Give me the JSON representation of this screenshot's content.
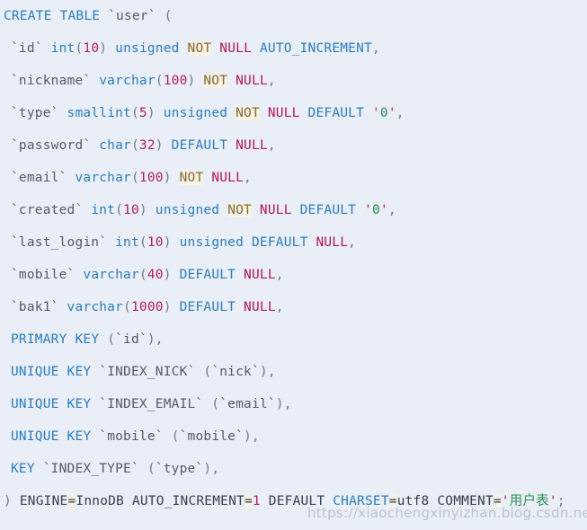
{
  "editor": {
    "language": "sql",
    "background_color": "#e9eef7",
    "keyword_color": "#2b7dbc",
    "null_color": "#b0165c",
    "number_color": "#b02060",
    "string_color": "#2f8f4e",
    "identifier_color": "#555b66",
    "highlight_color": "#f7f3e3"
  },
  "watermark": {
    "text": "https://xiaochengxinyizhan.blog.csdn.net"
  },
  "sql": {
    "statement_name": "create-table-user",
    "lines": [
      {
        "id": "line-create-table",
        "indent": false,
        "tokens": [
          {
            "t": "CREATE",
            "c": "kw"
          },
          {
            "t": " ",
            "c": "plain"
          },
          {
            "t": "TABLE",
            "c": "kw"
          },
          {
            "t": " ",
            "c": "plain"
          },
          {
            "t": "`user`",
            "c": "ident"
          },
          {
            "t": " ",
            "c": "plain"
          },
          {
            "t": "(",
            "c": "punct"
          }
        ]
      },
      {
        "id": "line-col-id",
        "indent": true,
        "tokens": [
          {
            "t": "`id`",
            "c": "ident"
          },
          {
            "t": " ",
            "c": "plain"
          },
          {
            "t": "int",
            "c": "type"
          },
          {
            "t": "(",
            "c": "punct"
          },
          {
            "t": "10",
            "c": "num"
          },
          {
            "t": ")",
            "c": "punct"
          },
          {
            "t": " ",
            "c": "plain"
          },
          {
            "t": "unsigned",
            "c": "kw"
          },
          {
            "t": " ",
            "c": "plain"
          },
          {
            "t": "NOT",
            "c": "notkw"
          },
          {
            "t": " ",
            "c": "plain"
          },
          {
            "t": "NULL",
            "c": "nullkw"
          },
          {
            "t": " ",
            "c": "plain"
          },
          {
            "t": "AUTO_INCREMENT",
            "c": "kw"
          },
          {
            "t": ",",
            "c": "punct"
          }
        ]
      },
      {
        "id": "line-col-nickname",
        "indent": true,
        "tokens": [
          {
            "t": "`nickname`",
            "c": "ident"
          },
          {
            "t": " ",
            "c": "plain"
          },
          {
            "t": "varchar",
            "c": "type"
          },
          {
            "t": "(",
            "c": "punct"
          },
          {
            "t": "100",
            "c": "num"
          },
          {
            "t": ")",
            "c": "punct"
          },
          {
            "t": " ",
            "c": "plain"
          },
          {
            "t": "NOT",
            "c": "notkw"
          },
          {
            "t": " ",
            "c": "plain"
          },
          {
            "t": "NULL",
            "c": "nullkw"
          },
          {
            "t": ",",
            "c": "punct"
          }
        ]
      },
      {
        "id": "line-col-type",
        "indent": true,
        "tokens": [
          {
            "t": "`type`",
            "c": "ident"
          },
          {
            "t": " ",
            "c": "plain"
          },
          {
            "t": "smallint",
            "c": "type"
          },
          {
            "t": "(",
            "c": "punct"
          },
          {
            "t": "5",
            "c": "num"
          },
          {
            "t": ")",
            "c": "punct"
          },
          {
            "t": " ",
            "c": "plain"
          },
          {
            "t": "unsigned",
            "c": "kw"
          },
          {
            "t": " ",
            "c": "plain"
          },
          {
            "t": "NOT",
            "c": "notkw"
          },
          {
            "t": " ",
            "c": "plain"
          },
          {
            "t": "NULL",
            "c": "nullkw"
          },
          {
            "t": " ",
            "c": "plain"
          },
          {
            "t": "DEFAULT",
            "c": "kw"
          },
          {
            "t": " ",
            "c": "plain"
          },
          {
            "t": "'",
            "c": "strq"
          },
          {
            "t": "0",
            "c": "strv"
          },
          {
            "t": "'",
            "c": "strq"
          },
          {
            "t": ",",
            "c": "punct"
          }
        ]
      },
      {
        "id": "line-col-password",
        "indent": true,
        "tokens": [
          {
            "t": "`password`",
            "c": "ident"
          },
          {
            "t": " ",
            "c": "plain"
          },
          {
            "t": "char",
            "c": "type"
          },
          {
            "t": "(",
            "c": "punct"
          },
          {
            "t": "32",
            "c": "num"
          },
          {
            "t": ")",
            "c": "punct"
          },
          {
            "t": " ",
            "c": "plain"
          },
          {
            "t": "DEFAULT",
            "c": "kw"
          },
          {
            "t": " ",
            "c": "plain"
          },
          {
            "t": "NULL",
            "c": "nullkw"
          },
          {
            "t": ",",
            "c": "punct"
          }
        ]
      },
      {
        "id": "line-col-email",
        "indent": true,
        "tokens": [
          {
            "t": "`email`",
            "c": "ident"
          },
          {
            "t": " ",
            "c": "plain"
          },
          {
            "t": "varchar",
            "c": "type"
          },
          {
            "t": "(",
            "c": "punct"
          },
          {
            "t": "100",
            "c": "num"
          },
          {
            "t": ")",
            "c": "punct"
          },
          {
            "t": " ",
            "c": "plain"
          },
          {
            "t": "NOT",
            "c": "notkw"
          },
          {
            "t": " ",
            "c": "plain"
          },
          {
            "t": "NULL",
            "c": "nullkw"
          },
          {
            "t": ",",
            "c": "punct"
          }
        ]
      },
      {
        "id": "line-col-created",
        "indent": true,
        "tokens": [
          {
            "t": "`created`",
            "c": "ident"
          },
          {
            "t": " ",
            "c": "plain"
          },
          {
            "t": "int",
            "c": "type"
          },
          {
            "t": "(",
            "c": "punct"
          },
          {
            "t": "10",
            "c": "num"
          },
          {
            "t": ")",
            "c": "punct"
          },
          {
            "t": " ",
            "c": "plain"
          },
          {
            "t": "unsigned",
            "c": "kw"
          },
          {
            "t": " ",
            "c": "plain"
          },
          {
            "t": "NOT",
            "c": "notkw"
          },
          {
            "t": " ",
            "c": "plain"
          },
          {
            "t": "NULL",
            "c": "nullkw"
          },
          {
            "t": " ",
            "c": "plain"
          },
          {
            "t": "DEFAULT",
            "c": "kw"
          },
          {
            "t": " ",
            "c": "plain"
          },
          {
            "t": "'",
            "c": "strq"
          },
          {
            "t": "0",
            "c": "strv"
          },
          {
            "t": "'",
            "c": "strq"
          },
          {
            "t": ",",
            "c": "punct"
          }
        ]
      },
      {
        "id": "line-col-last-login",
        "indent": true,
        "tokens": [
          {
            "t": "`last_login`",
            "c": "ident"
          },
          {
            "t": " ",
            "c": "plain"
          },
          {
            "t": "int",
            "c": "type"
          },
          {
            "t": "(",
            "c": "punct"
          },
          {
            "t": "10",
            "c": "num"
          },
          {
            "t": ")",
            "c": "punct"
          },
          {
            "t": " ",
            "c": "plain"
          },
          {
            "t": "unsigned",
            "c": "kw"
          },
          {
            "t": " ",
            "c": "plain"
          },
          {
            "t": "DEFAULT",
            "c": "kw"
          },
          {
            "t": " ",
            "c": "plain"
          },
          {
            "t": "NULL",
            "c": "nullkw"
          },
          {
            "t": ",",
            "c": "punct"
          }
        ]
      },
      {
        "id": "line-col-mobile",
        "indent": true,
        "tokens": [
          {
            "t": "`mobile`",
            "c": "ident"
          },
          {
            "t": " ",
            "c": "plain"
          },
          {
            "t": "varchar",
            "c": "type"
          },
          {
            "t": "(",
            "c": "punct"
          },
          {
            "t": "40",
            "c": "num"
          },
          {
            "t": ")",
            "c": "punct"
          },
          {
            "t": " ",
            "c": "plain"
          },
          {
            "t": "DEFAULT",
            "c": "kw"
          },
          {
            "t": " ",
            "c": "plain"
          },
          {
            "t": "NULL",
            "c": "nullkw"
          },
          {
            "t": ",",
            "c": "punct"
          }
        ]
      },
      {
        "id": "line-col-bak1",
        "indent": true,
        "tokens": [
          {
            "t": "`bak1`",
            "c": "ident"
          },
          {
            "t": " ",
            "c": "plain"
          },
          {
            "t": "varchar",
            "c": "type"
          },
          {
            "t": "(",
            "c": "punct"
          },
          {
            "t": "1000",
            "c": "num"
          },
          {
            "t": ")",
            "c": "punct"
          },
          {
            "t": " ",
            "c": "plain"
          },
          {
            "t": "DEFAULT",
            "c": "kw"
          },
          {
            "t": " ",
            "c": "plain"
          },
          {
            "t": "NULL",
            "c": "nullkw"
          },
          {
            "t": ",",
            "c": "punct"
          }
        ]
      },
      {
        "id": "line-primary-key",
        "indent": true,
        "tokens": [
          {
            "t": "PRIMARY",
            "c": "kw"
          },
          {
            "t": " ",
            "c": "plain"
          },
          {
            "t": "KEY",
            "c": "kw"
          },
          {
            "t": " ",
            "c": "plain"
          },
          {
            "t": "(",
            "c": "punct"
          },
          {
            "t": "`id`",
            "c": "ident"
          },
          {
            "t": ")",
            "c": "punct"
          },
          {
            "t": ",",
            "c": "punct"
          }
        ]
      },
      {
        "id": "line-unique-key-index-nick",
        "indent": true,
        "tokens": [
          {
            "t": "UNIQUE",
            "c": "kw"
          },
          {
            "t": " ",
            "c": "plain"
          },
          {
            "t": "KEY",
            "c": "kw"
          },
          {
            "t": " ",
            "c": "plain"
          },
          {
            "t": "`INDEX_NICK`",
            "c": "ident"
          },
          {
            "t": " ",
            "c": "plain"
          },
          {
            "t": "(",
            "c": "punct"
          },
          {
            "t": "`nick`",
            "c": "ident"
          },
          {
            "t": ")",
            "c": "punct"
          },
          {
            "t": ",",
            "c": "punct"
          }
        ]
      },
      {
        "id": "line-unique-key-index-email",
        "indent": true,
        "tokens": [
          {
            "t": "UNIQUE",
            "c": "kw"
          },
          {
            "t": " ",
            "c": "plain"
          },
          {
            "t": "KEY",
            "c": "kw"
          },
          {
            "t": " ",
            "c": "plain"
          },
          {
            "t": "`INDEX_EMAIL`",
            "c": "ident"
          },
          {
            "t": " ",
            "c": "plain"
          },
          {
            "t": "(",
            "c": "punct"
          },
          {
            "t": "`email`",
            "c": "ident"
          },
          {
            "t": ")",
            "c": "punct"
          },
          {
            "t": ",",
            "c": "punct"
          }
        ]
      },
      {
        "id": "line-unique-key-mobile",
        "indent": true,
        "tokens": [
          {
            "t": "UNIQUE",
            "c": "kw"
          },
          {
            "t": " ",
            "c": "plain"
          },
          {
            "t": "KEY",
            "c": "kw"
          },
          {
            "t": " ",
            "c": "plain"
          },
          {
            "t": "`mobile`",
            "c": "ident"
          },
          {
            "t": " ",
            "c": "plain"
          },
          {
            "t": "(",
            "c": "punct"
          },
          {
            "t": "`mobile`",
            "c": "ident"
          },
          {
            "t": ")",
            "c": "punct"
          },
          {
            "t": ",",
            "c": "punct"
          }
        ]
      },
      {
        "id": "line-key-index-type",
        "indent": true,
        "tokens": [
          {
            "t": "KEY",
            "c": "kw"
          },
          {
            "t": " ",
            "c": "plain"
          },
          {
            "t": "`INDEX_TYPE`",
            "c": "ident"
          },
          {
            "t": " ",
            "c": "plain"
          },
          {
            "t": "(",
            "c": "punct"
          },
          {
            "t": "`type`",
            "c": "ident"
          },
          {
            "t": ")",
            "c": "punct"
          },
          {
            "t": ",",
            "c": "punct"
          }
        ]
      },
      {
        "id": "line-table-options",
        "indent": false,
        "tokens": [
          {
            "t": ")",
            "c": "punct"
          },
          {
            "t": " ",
            "c": "plain"
          },
          {
            "t": "ENGINE",
            "c": "plain"
          },
          {
            "t": "=",
            "c": "eq"
          },
          {
            "t": "InnoDB",
            "c": "plain"
          },
          {
            "t": " ",
            "c": "plain"
          },
          {
            "t": "AUTO_INCREMENT",
            "c": "plain"
          },
          {
            "t": "=",
            "c": "eq"
          },
          {
            "t": "1",
            "c": "num"
          },
          {
            "t": " ",
            "c": "plain"
          },
          {
            "t": "DEFAULT",
            "c": "plain"
          },
          {
            "t": " ",
            "c": "plain"
          },
          {
            "t": "CHARSET",
            "c": "kw"
          },
          {
            "t": "=",
            "c": "eq"
          },
          {
            "t": "utf8",
            "c": "plain"
          },
          {
            "t": " ",
            "c": "plain"
          },
          {
            "t": "COMMENT",
            "c": "plain"
          },
          {
            "t": "=",
            "c": "eq"
          },
          {
            "t": "'",
            "c": "strq"
          },
          {
            "t": "用户表",
            "c": "cjk"
          },
          {
            "t": "'",
            "c": "strq"
          },
          {
            "t": ";",
            "c": "punct"
          }
        ]
      }
    ]
  }
}
